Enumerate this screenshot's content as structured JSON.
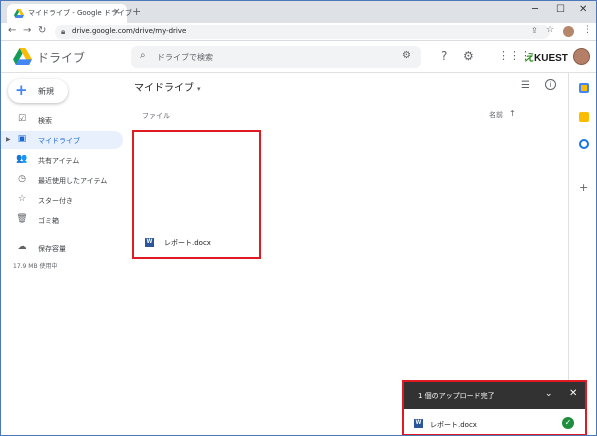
{
  "browser": {
    "tab_title": "マイドライブ - Google ドライブ",
    "tab_close": "×",
    "new_tab": "+",
    "minimize": "─",
    "maximize": "☐",
    "close": "✕",
    "url": "drive.google.com/drive/my-drive"
  },
  "header": {
    "app_name": "ドライブ",
    "search_placeholder": "ドライブで検索",
    "brand_text": "KUEST",
    "brand_prefix": "え"
  },
  "sidebar": {
    "new_button": "新規",
    "items": [
      {
        "label": "検索",
        "icon": "☑"
      },
      {
        "label": "マイドライブ",
        "icon": "▣"
      },
      {
        "label": "共有アイテム",
        "icon": "👥"
      },
      {
        "label": "最近使用したアイテム",
        "icon": "◷"
      },
      {
        "label": "スター付き",
        "icon": "☆"
      },
      {
        "label": "ゴミ箱",
        "icon": "🗑"
      },
      {
        "label": "保存容量",
        "icon": "☁"
      }
    ],
    "storage_used": "17.9 MB 使用中"
  },
  "main": {
    "title": "マイドライブ",
    "section_label": "ファイル",
    "sort_label": "名前",
    "files": [
      {
        "name": "レポート.docx",
        "icon_letter": "W"
      }
    ]
  },
  "toast": {
    "title": "1 個のアップロード完了",
    "file_name": "レポート.docx",
    "icon_letter": "W"
  },
  "colors": {
    "accent": "#1967d2",
    "highlight_border": "#e01a22",
    "word_blue": "#2b579a",
    "success": "#1e8e3e"
  }
}
